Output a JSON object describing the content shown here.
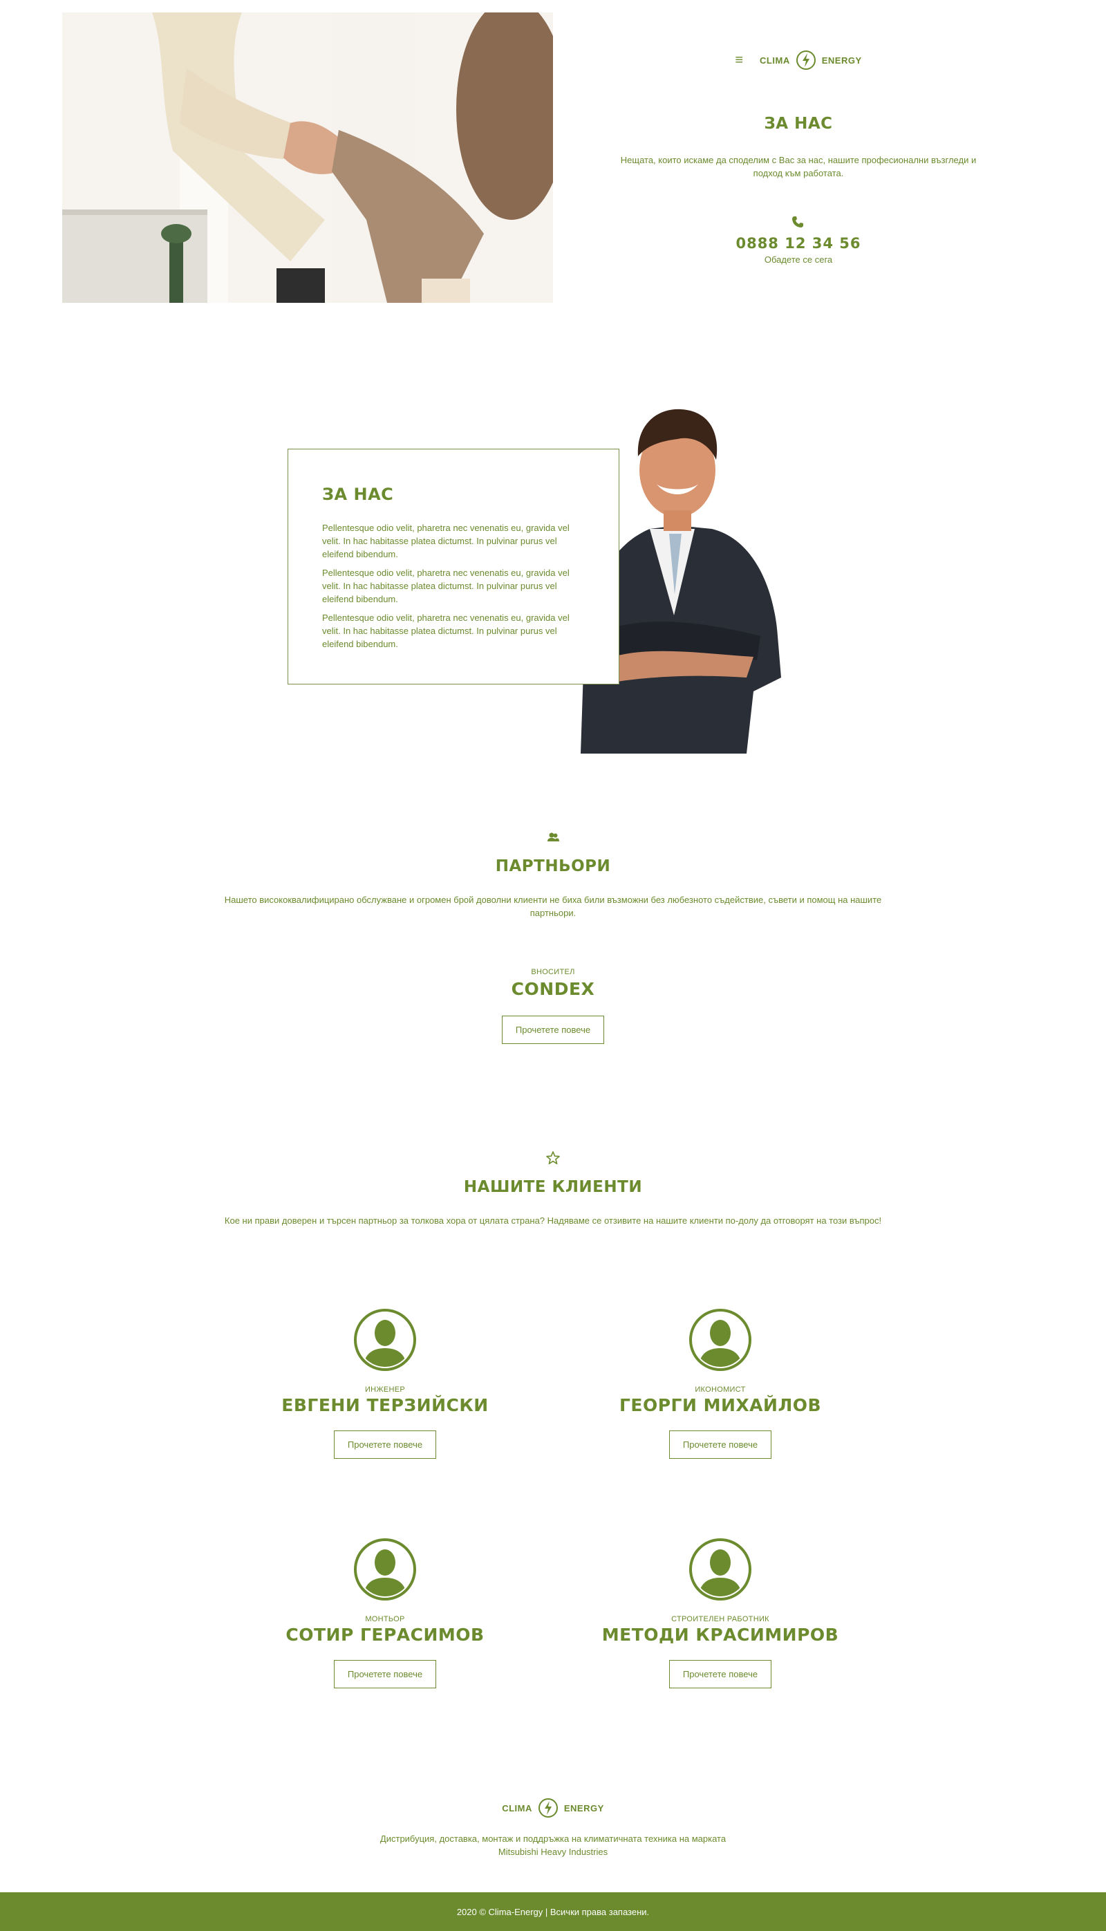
{
  "colors": {
    "brand_green": "#6b8b2e",
    "footer_bg": "#6b8b2e",
    "text_on_footer": "#ffffff"
  },
  "header": {
    "logo_left": "CLIMA",
    "logo_right": "ENERGY",
    "menu_icon": "hamburger-icon",
    "title": "ЗА НАС",
    "lead": "Нещата, които искаме да споделим с Вас за нас, нашите професионални възгледи и подход към работата.",
    "phone_icon": "phone-icon",
    "phone": "0888 12 34 56",
    "phone_sub": "Обадете се сега"
  },
  "about": {
    "title": "ЗА НАС",
    "paragraphs": [
      "Pellentesque odio velit, pharetra nec venenatis eu, gravida vel velit. In hac habitasse platea dictumst. In pulvinar purus vel eleifend bibendum.",
      "Pellentesque odio velit, pharetra nec venenatis eu, gravida vel velit. In hac habitasse platea dictumst. In pulvinar purus vel eleifend bibendum.",
      "Pellentesque odio velit, pharetra nec venenatis eu, gravida vel velit. In hac habitasse platea dictumst. In pulvinar purus vel eleifend bibendum."
    ]
  },
  "partners": {
    "icon": "users-icon",
    "title": "ПАРТНЬОРИ",
    "desc": "Нашето висококвалифицирано обслужване и огромен брой доволни клиенти не биха били възможни без любезното съдействие, съвети и помощ на нашите партньори.",
    "item": {
      "role": "ВНОСИТЕЛ",
      "name": "CONDEX",
      "button": "Прочетете повече"
    }
  },
  "clients": {
    "icon": "star-icon",
    "title": "НАШИТЕ КЛИЕНТИ",
    "desc": "Кое ни прави доверен и търсен партньор за толкова хора от цялата страна? Надяваме се отзивите на нашите клиенти по-долу да отговорят на този въпрос!",
    "items": [
      {
        "role": "ИНЖЕНЕР",
        "name": "ЕВГЕНИ ТЕРЗИЙСКИ",
        "button": "Прочетете повече"
      },
      {
        "role": "ИКОНОМИСТ",
        "name": "ГЕОРГИ МИХАЙЛОВ",
        "button": "Прочетете повече"
      },
      {
        "role": "МОНТЬОР",
        "name": "СОТИР ГЕРАСИМОВ",
        "button": "Прочетете повече"
      },
      {
        "role": "СТРОИТЕЛЕН РАБОТНИК",
        "name": "МЕТОДИ КРАСИМИРОВ",
        "button": "Прочетете повече"
      }
    ]
  },
  "footer": {
    "logo_left": "CLIMA",
    "logo_right": "ENERGY",
    "desc_line1": "Дистрибуция, доставка, монтаж и поддръжка на климатичната техника на марката",
    "desc_line2": "Mitsubishi Heavy Industries",
    "copyright": "2020 © Clima-Energy | Всички права запазени."
  }
}
